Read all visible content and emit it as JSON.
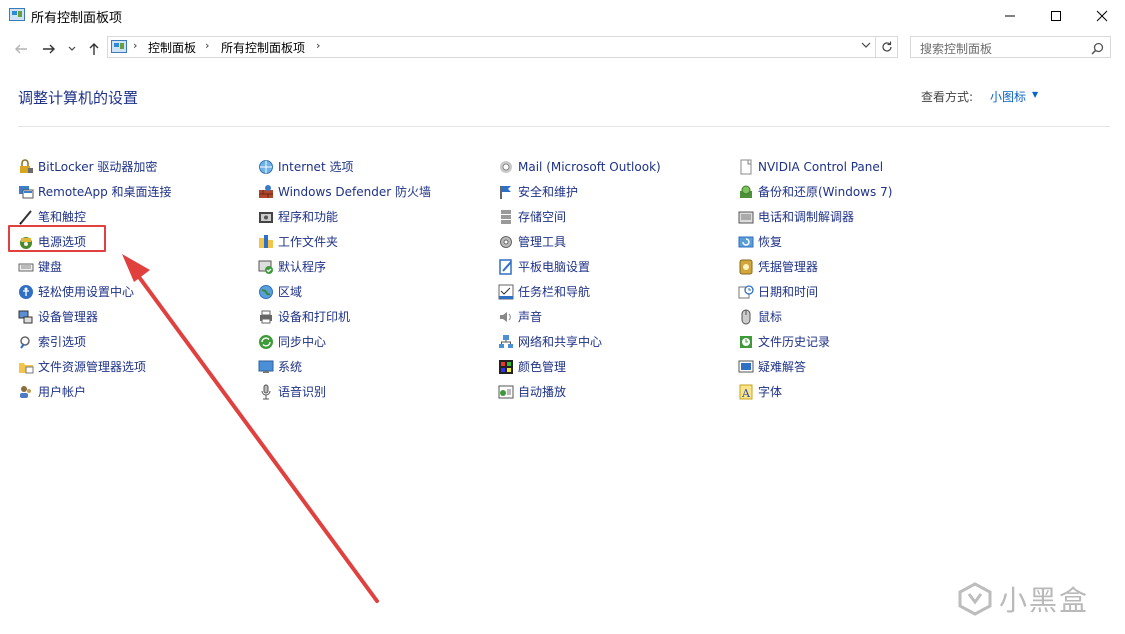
{
  "window": {
    "title": "所有控制面板项"
  },
  "address": {
    "crumbs": [
      "控制面板",
      "所有控制面板项"
    ],
    "search_placeholder": "搜索控制面板"
  },
  "header": {
    "title": "调整计算机的设置",
    "view_label": "查看方式:",
    "view_value": "小图标"
  },
  "columns": [
    [
      {
        "label": "BitLocker 驱动器加密",
        "icon": "bitlocker-icon"
      },
      {
        "label": "RemoteApp 和桌面连接",
        "icon": "remoteapp-icon"
      },
      {
        "label": "笔和触控",
        "icon": "pen-icon"
      },
      {
        "label": "电源选项",
        "icon": "power-options-icon"
      },
      {
        "label": "键盘",
        "icon": "keyboard-icon"
      },
      {
        "label": "轻松使用设置中心",
        "icon": "ease-of-access-icon"
      },
      {
        "label": "设备管理器",
        "icon": "device-manager-icon"
      },
      {
        "label": "索引选项",
        "icon": "indexing-icon"
      },
      {
        "label": "文件资源管理器选项",
        "icon": "folder-options-icon"
      },
      {
        "label": "用户帐户",
        "icon": "user-accounts-icon"
      }
    ],
    [
      {
        "label": "Internet 选项",
        "icon": "internet-options-icon"
      },
      {
        "label": "Windows Defender 防火墙",
        "icon": "firewall-icon"
      },
      {
        "label": "程序和功能",
        "icon": "programs-icon"
      },
      {
        "label": "工作文件夹",
        "icon": "work-folders-icon"
      },
      {
        "label": "默认程序",
        "icon": "default-programs-icon"
      },
      {
        "label": "区域",
        "icon": "region-icon"
      },
      {
        "label": "设备和打印机",
        "icon": "printer-icon"
      },
      {
        "label": "同步中心",
        "icon": "sync-icon"
      },
      {
        "label": "系统",
        "icon": "system-icon"
      },
      {
        "label": "语音识别",
        "icon": "microphone-icon"
      }
    ],
    [
      {
        "label": "Mail (Microsoft Outlook)",
        "icon": "mail-icon"
      },
      {
        "label": "安全和维护",
        "icon": "flag-icon"
      },
      {
        "label": "存储空间",
        "icon": "storage-icon"
      },
      {
        "label": "管理工具",
        "icon": "admin-tools-icon"
      },
      {
        "label": "平板电脑设置",
        "icon": "tablet-icon"
      },
      {
        "label": "任务栏和导航",
        "icon": "taskbar-icon"
      },
      {
        "label": "声音",
        "icon": "speaker-icon"
      },
      {
        "label": "网络和共享中心",
        "icon": "network-icon"
      },
      {
        "label": "颜色管理",
        "icon": "color-icon"
      },
      {
        "label": "自动播放",
        "icon": "autoplay-icon"
      }
    ],
    [
      {
        "label": "NVIDIA Control Panel",
        "icon": "nvidia-icon"
      },
      {
        "label": "备份和还原(Windows 7)",
        "icon": "backup-icon"
      },
      {
        "label": "电话和调制解调器",
        "icon": "phone-modem-icon"
      },
      {
        "label": "恢复",
        "icon": "recovery-icon"
      },
      {
        "label": "凭据管理器",
        "icon": "credential-icon"
      },
      {
        "label": "日期和时间",
        "icon": "clock-icon"
      },
      {
        "label": "鼠标",
        "icon": "mouse-icon"
      },
      {
        "label": "文件历史记录",
        "icon": "file-history-icon"
      },
      {
        "label": "疑难解答",
        "icon": "troubleshoot-icon"
      },
      {
        "label": "字体",
        "icon": "font-icon"
      }
    ]
  ],
  "watermark": {
    "text": "小黑盒"
  },
  "colors": {
    "link": "#1e3287",
    "accent": "#0a65c4",
    "annotation": "#e0413f"
  }
}
